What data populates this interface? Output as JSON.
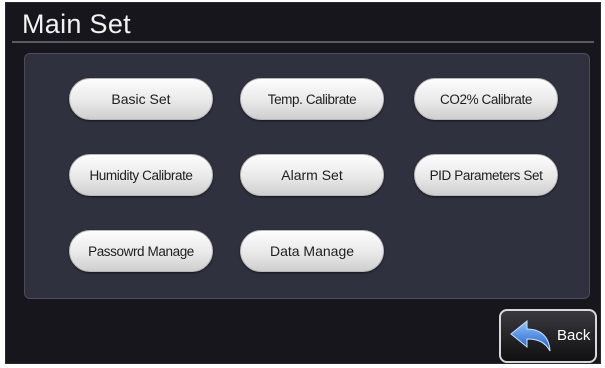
{
  "header": {
    "title": "Main Set"
  },
  "menu": {
    "basic_set": "Basic Set",
    "temp_calibrate": "Temp. Calibrate",
    "co2_calibrate": "CO2% Calibrate",
    "humidity_calibrate": "Humidity Calibrate",
    "alarm_set": "Alarm Set",
    "pid_parameters_set": "PID Parameters Set",
    "password_manage": "Passowrd Manage",
    "data_manage": "Data Manage"
  },
  "footer": {
    "back_label": "Back",
    "back_icon": "back-arrow-icon"
  },
  "colors": {
    "background": "#16161c",
    "panel": "#2f323e",
    "button": "#e9e9e9",
    "back_arrow": "#2f6fd6"
  }
}
